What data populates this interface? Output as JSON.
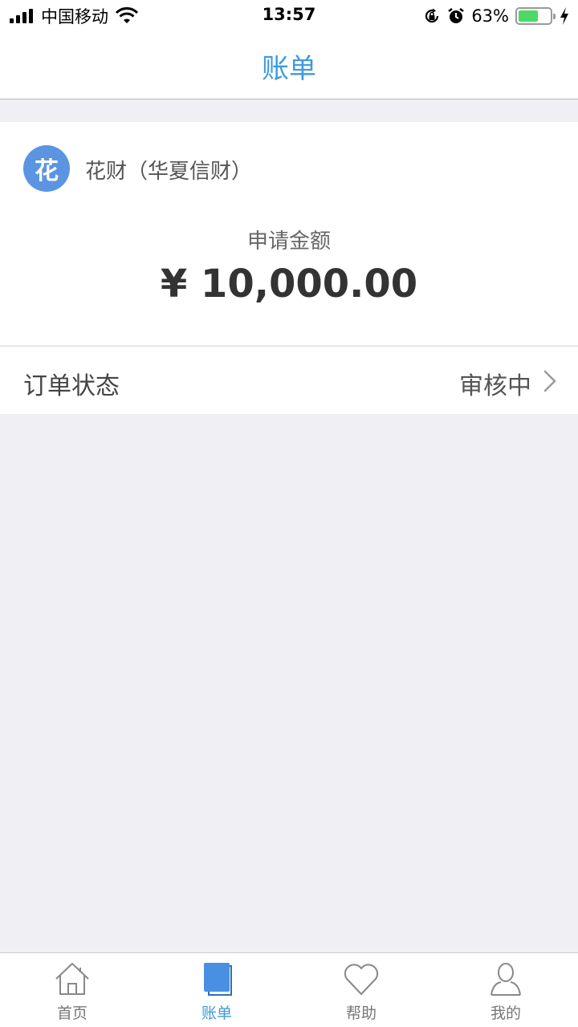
{
  "status_bar": {
    "carrier": "中国移动",
    "time": "13:57",
    "battery_percent": "63%",
    "battery_level": 0.63,
    "icons": [
      "signal-icon",
      "wifi-icon",
      "rotation-lock-icon",
      "alarm-icon",
      "battery-icon",
      "charging-icon"
    ]
  },
  "nav": {
    "title": "账单"
  },
  "order": {
    "lender_badge": "花",
    "lender_name": "花财（华夏信财）",
    "amount_label": "申请金额",
    "amount_value": "¥ 10,000.00"
  },
  "status_row": {
    "label": "订单状态",
    "value": "审核中"
  },
  "tabs": [
    {
      "label": "首页",
      "icon": "home-icon",
      "active": false
    },
    {
      "label": "账单",
      "icon": "bill-icon",
      "active": true
    },
    {
      "label": "帮助",
      "icon": "heart-icon",
      "active": false
    },
    {
      "label": "我的",
      "icon": "user-icon",
      "active": false
    }
  ],
  "colors": {
    "accent": "#3c9bde",
    "avatar": "#5b95e2",
    "battery": "#4cd964",
    "background": "#efeff4"
  }
}
